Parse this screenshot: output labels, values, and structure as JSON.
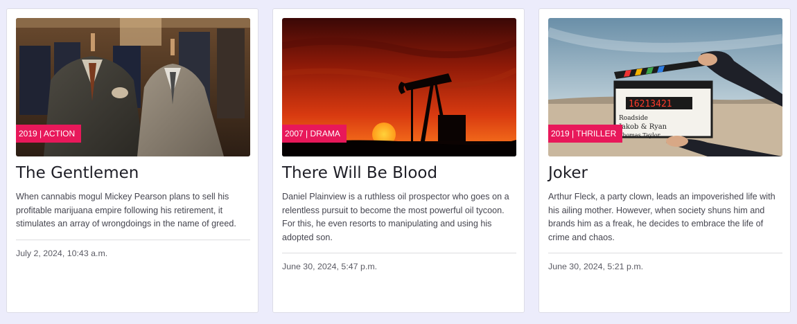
{
  "theme": {
    "badge_color": "#e8185a",
    "page_background": "#ececfb"
  },
  "movies": [
    {
      "year_genre": "2019 | ACTION",
      "title": "The Gentlemen",
      "description": "When cannabis mogul Mickey Pearson plans to sell his profitable marijuana empire following his retirement, it stimulates an array of wrongdoings in the name of greed.",
      "date": "July 2, 2024, 10:43 a.m.",
      "image": "mannequins-in-suits-image"
    },
    {
      "year_genre": "2007 | DRAMA",
      "title": "There Will Be Blood",
      "description": "Daniel Plainview is a ruthless oil prospector who goes on a relentless pursuit to become the most powerful oil tycoon. For this, he even resorts to manipulating and using his adopted son.",
      "date": "June 30, 2024, 5:47 p.m.",
      "image": "oil-pump-sunset-image"
    },
    {
      "year_genre": "2019 | THRILLER",
      "title": "Joker",
      "description": "Arthur Fleck, a party clown, leads an impoverished life with his ailing mother. However, when society shuns him and brands him as a freak, he decides to embrace the life of crime and chaos.",
      "date": "June 30, 2024, 5:21 p.m.",
      "image": "film-clapperboard-image",
      "clapperboard_text": {
        "counter": "16213421",
        "roll": "Roadside",
        "director": "Jakob & Ryan",
        "camera": "Thomas Taylor"
      }
    }
  ]
}
